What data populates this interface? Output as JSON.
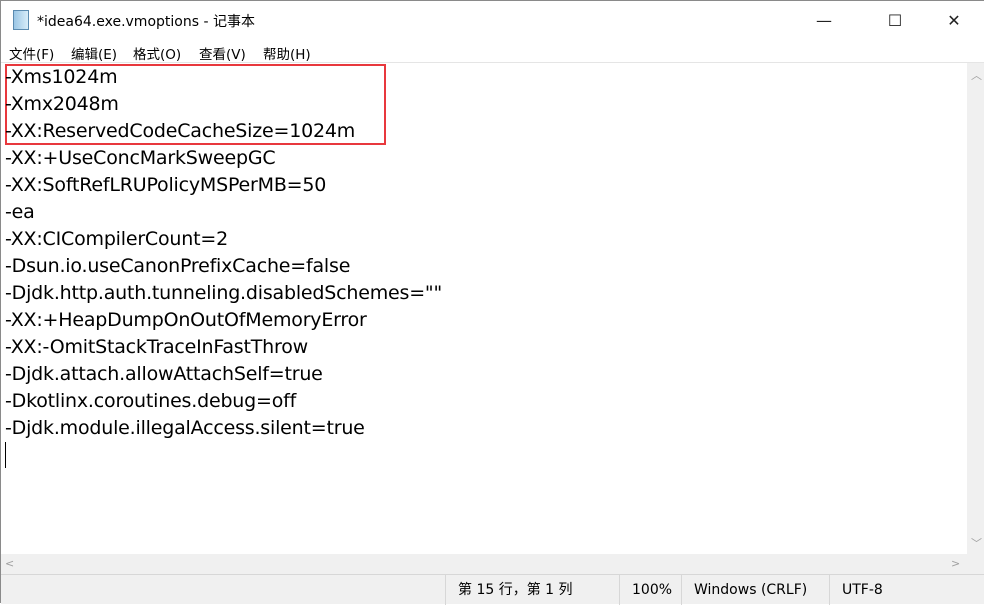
{
  "window": {
    "title": "*idea64.exe.vmoptions - 记事本",
    "icon": "notepad-icon"
  },
  "controls": {
    "minimize": "—",
    "maximize": "☐",
    "close": "✕"
  },
  "menu": [
    "文件(F)",
    "编辑(E)",
    "格式(O)",
    "查看(V)",
    "帮助(H)"
  ],
  "lines": [
    "-Xms1024m",
    "-Xmx2048m",
    "-XX:ReservedCodeCacheSize=1024m",
    "-XX:+UseConcMarkSweepGC",
    "-XX:SoftRefLRUPolicyMSPerMB=50",
    "-ea",
    "-XX:CICompilerCount=2",
    "-Dsun.io.useCanonPrefixCache=false",
    "-Djdk.http.auth.tunneling.disabledSchemes=\"\"",
    "-XX:+HeapDumpOnOutOfMemoryError",
    "-XX:-OmitStackTraceInFastThrow",
    "-Djdk.attach.allowAttachSelf=true",
    "-Dkotlinx.coroutines.debug=off",
    "-Djdk.module.illegalAccess.silent=true"
  ],
  "highlight_color": "#e8383d",
  "status": {
    "position": "第 15 行，第 1 列",
    "zoom": "100%",
    "line_ending": "Windows (CRLF)",
    "encoding": "UTF-8"
  }
}
